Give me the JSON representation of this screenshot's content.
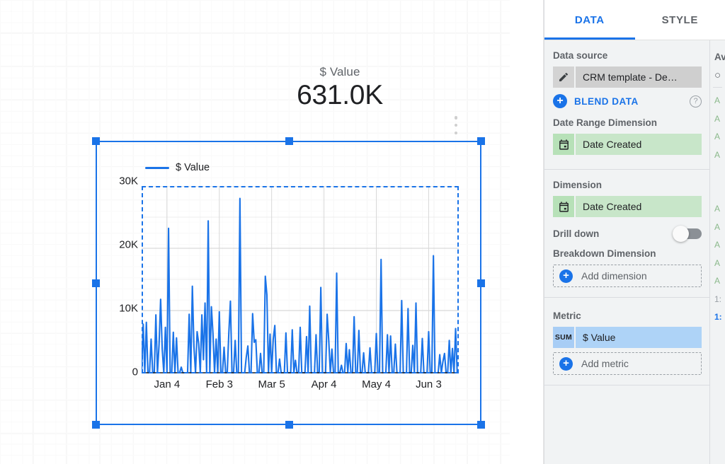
{
  "canvas": {
    "scorecard": {
      "label": "$ Value",
      "value": "631.0K"
    },
    "kebab_menu": "more-options"
  },
  "chart": {
    "legend_label": "$ Value",
    "y_ticks": [
      "30K",
      "20K",
      "10K",
      "0"
    ],
    "x_ticks": [
      "Jan 4",
      "Feb 3",
      "Mar 5",
      "Apr 4",
      "May 4",
      "Jun 3"
    ]
  },
  "chart_data": {
    "type": "line",
    "title": "$ Value",
    "xlabel": "",
    "ylabel": "",
    "ylim": [
      0,
      30000
    ],
    "yticks": [
      0,
      10000,
      20000,
      30000
    ],
    "ytick_labels": [
      "0",
      "10K",
      "20K",
      "30K"
    ],
    "xticks": [
      "Jan 4",
      "Feb 3",
      "Mar 5",
      "Apr 4",
      "May 4",
      "Jun 3"
    ],
    "grid": true,
    "legend_position": "top-left",
    "series": [
      {
        "name": "$ Value",
        "color": "#1a73e8",
        "values": [
          0,
          7800,
          0,
          8100,
          0,
          0,
          5400,
          0,
          0,
          9300,
          0,
          4500,
          11800,
          3800,
          0,
          7300,
          0,
          23200,
          0,
          0,
          6500,
          0,
          5600,
          0,
          0,
          900,
          0,
          0,
          0,
          0,
          9400,
          0,
          13900,
          4200,
          0,
          6600,
          4700,
          0,
          9300,
          2100,
          11200,
          0,
          24400,
          0,
          10600,
          6300,
          0,
          5400,
          0,
          9800,
          0,
          0,
          4100,
          0,
          0,
          6400,
          11500,
          0,
          0,
          5200,
          0,
          0,
          28000,
          0,
          0,
          0,
          2500,
          4300,
          0,
          0,
          9500,
          4900,
          5300,
          0,
          0,
          3100,
          0,
          0,
          15500,
          12500,
          0,
          6200,
          0,
          5400,
          7600,
          0,
          0,
          2200,
          0,
          0,
          0,
          6400,
          0,
          0,
          0,
          6900,
          0,
          2000,
          0,
          0,
          7300,
          0,
          0,
          0,
          5800,
          0,
          10700,
          0,
          0,
          0,
          6100,
          0,
          0,
          13700,
          0,
          0,
          0,
          9400,
          5200,
          0,
          3800,
          0,
          0,
          16000,
          0,
          0,
          1200,
          0,
          0,
          4700,
          0,
          3700,
          0,
          0,
          9000,
          0,
          0,
          6800,
          0,
          0,
          3200,
          0,
          0,
          0,
          4000,
          0,
          0,
          0,
          6300,
          0,
          0,
          18200,
          0,
          0,
          0,
          6100,
          0,
          5900,
          0,
          0,
          4600,
          0,
          0,
          0,
          11600,
          0,
          0,
          0,
          10300,
          0,
          0,
          4400,
          0,
          11200,
          0,
          0,
          0,
          5500,
          0,
          0,
          0,
          6600,
          0,
          0,
          18800,
          0,
          0,
          0,
          2900,
          0,
          1800,
          3100,
          0,
          0,
          5200,
          0,
          3900,
          0,
          7100,
          0,
          0
        ]
      }
    ]
  },
  "panel": {
    "tabs": [
      {
        "id": "data",
        "label": "DATA",
        "active": true
      },
      {
        "id": "style",
        "label": "STYLE",
        "active": false
      }
    ],
    "data_source": {
      "title": "Data source",
      "chip_label": "CRM template - De…",
      "chip_icon": "pencil-icon",
      "blend_label": "BLEND DATA",
      "blend_help": "?"
    },
    "date_range": {
      "title": "Date Range Dimension",
      "chip_label": "Date Created",
      "chip_icon": "calendar-icon"
    },
    "dimension": {
      "title": "Dimension",
      "chip_label": "Date Created",
      "chip_icon": "calendar-icon"
    },
    "drill_down": {
      "label": "Drill down",
      "enabled": false
    },
    "breakdown": {
      "title": "Breakdown Dimension",
      "add_label": "Add dimension"
    },
    "metric": {
      "title": "Metric",
      "chip_agg": "SUM",
      "chip_label": "$ Value",
      "add_label": "Add metric"
    }
  },
  "available_fields": {
    "title": "Av",
    "search_icon": "search-icon",
    "items": [
      "A",
      "A",
      "A",
      "A",
      "",
      "",
      "A",
      "A",
      "A",
      "A",
      "A",
      "1:",
      "1:"
    ]
  },
  "colors": {
    "accent": "#1a73e8",
    "series": "#1a73e8",
    "panel_bg": "#f1f3f4",
    "green_chip": "#c8e6c9",
    "blue_chip": "#aed3f7",
    "gray_chip": "#cfcfcf"
  }
}
